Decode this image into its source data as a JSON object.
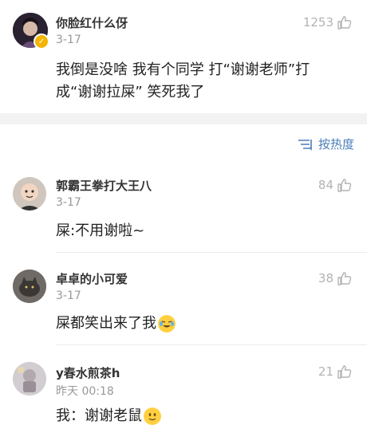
{
  "top_comment": {
    "user_name": "你脸红什么伢",
    "time": "3-17",
    "likes": "1253",
    "content_line1": "我倒是没啥 我有个同学 打“谢谢老师”打",
    "content_line2": "成“谢谢拉屎” 笑死我了"
  },
  "sort": {
    "label": "按热度"
  },
  "replies": [
    {
      "user_name": "郭霸王拳打大王八",
      "time": "3-17",
      "likes": "84",
      "content": "屎:不用谢啦~"
    },
    {
      "user_name": "卓卓的小可爱",
      "time": "3-17",
      "likes": "38",
      "content": "屎都笑出来了我"
    },
    {
      "user_name": "y春水煎茶h",
      "time": "昨天 00:18",
      "likes": "21",
      "content": "我：谢谢老鼠"
    }
  ],
  "colors": {
    "accent": "#4a7eb8",
    "muted": "#999999",
    "badge": "#f4b400"
  }
}
